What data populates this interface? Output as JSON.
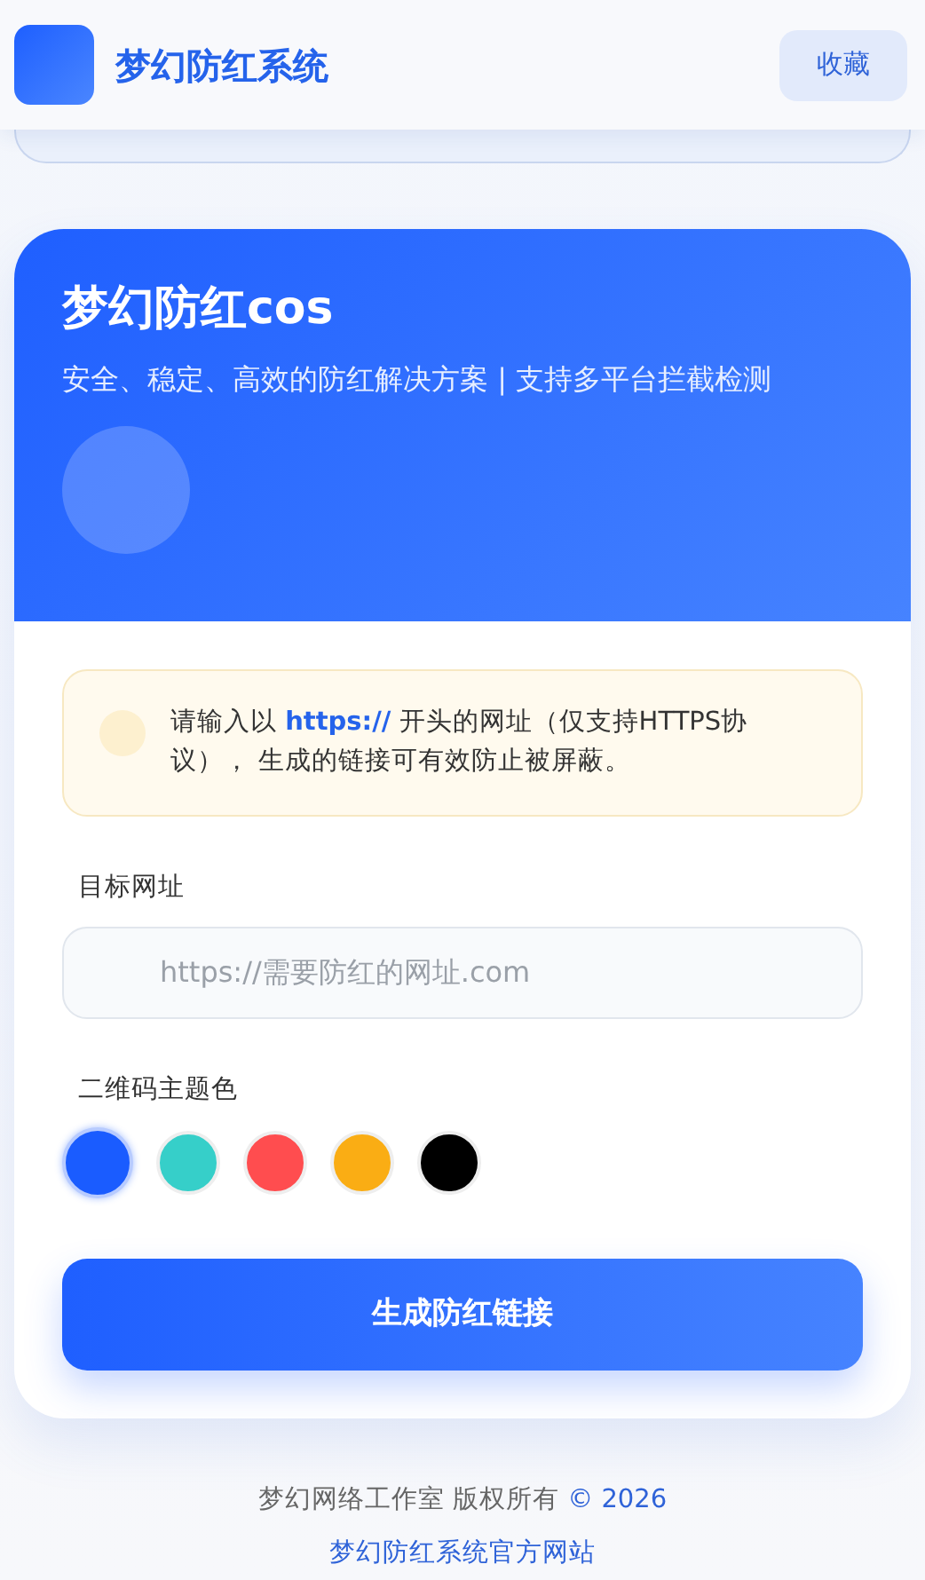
{
  "header": {
    "title": "梦幻防红系统",
    "button": "收藏"
  },
  "hero": {
    "title": "梦幻防红cos",
    "subtitle": "安全、稳定、高效的防红解决方案 | 支持多平台拦截检测"
  },
  "notice": {
    "text": "请输入以 **https://** 开头的网址（仅支持HTTPS协议）， 生成的链接可有效防止被屏蔽。"
  },
  "url_field": {
    "label": "目标网址",
    "placeholder": "https://需要防红的网址.com"
  },
  "theme_color": {
    "label": "二维码主题色",
    "swatches": [
      {
        "color": "#1a5cff",
        "selected": true
      },
      {
        "color": "#36cfc9",
        "selected": false
      },
      {
        "color": "#ff4d4f",
        "selected": false
      },
      {
        "color": "#faad14",
        "selected": false
      },
      {
        "color": "#000000",
        "selected": false
      }
    ]
  },
  "submit_button": "生成防红链接",
  "footer": {
    "owner": "梦幻网络工作室 版权所有",
    "year": "© 2026",
    "link": "梦幻防红系统官方网站"
  }
}
